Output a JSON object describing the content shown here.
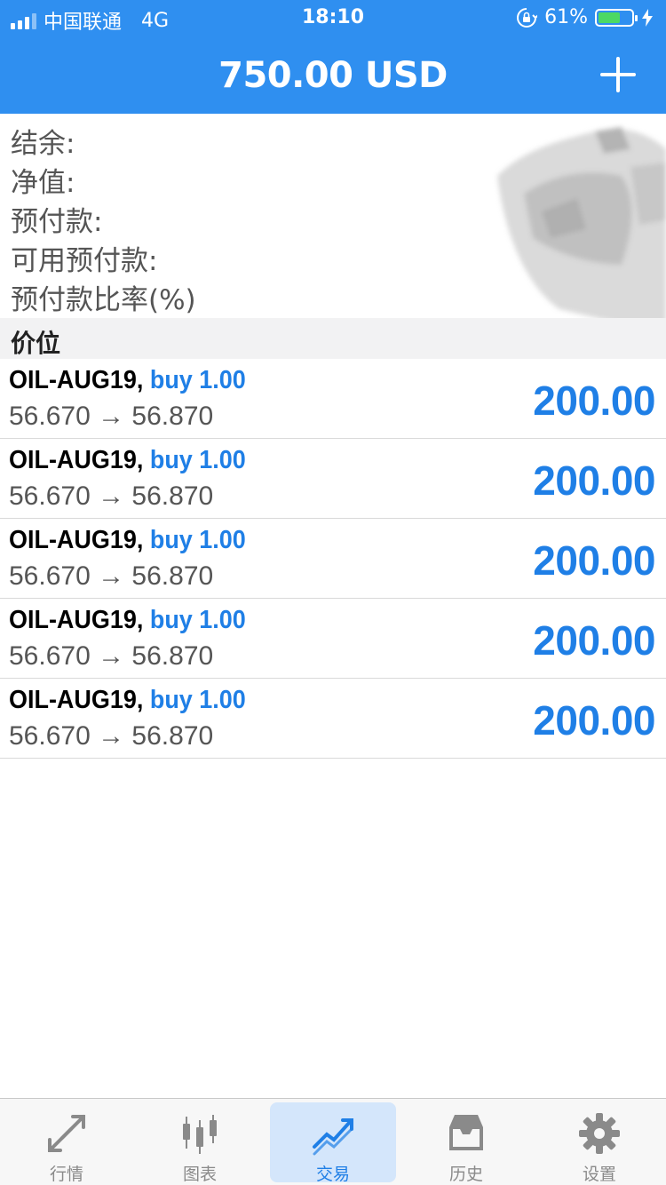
{
  "status_bar": {
    "carrier": "中国联通",
    "network": "4G",
    "time": "18:10",
    "battery": "61%"
  },
  "header": {
    "title": "750.00 USD"
  },
  "summary": {
    "balance_label": "结余:",
    "equity_label": "净值:",
    "margin_label": "预付款:",
    "free_margin_label": "可用预付款:",
    "margin_level_label": "预付款比率(%)"
  },
  "section": {
    "positions_title": "价位"
  },
  "positions": [
    {
      "symbol": "OIL-AUG19,",
      "side": "buy 1.00",
      "prices": "56.670 → 56.870",
      "profit": "200.00"
    },
    {
      "symbol": "OIL-AUG19,",
      "side": "buy 1.00",
      "prices": "56.670 → 56.870",
      "profit": "200.00"
    },
    {
      "symbol": "OIL-AUG19,",
      "side": "buy 1.00",
      "prices": "56.670 → 56.870",
      "profit": "200.00"
    },
    {
      "symbol": "OIL-AUG19,",
      "side": "buy 1.00",
      "prices": "56.670 → 56.870",
      "profit": "200.00"
    },
    {
      "symbol": "OIL-AUG19,",
      "side": "buy 1.00",
      "prices": "56.670 → 56.870",
      "profit": "200.00"
    }
  ],
  "tabs": [
    {
      "label": "行情",
      "icon": "quotes-arrows-icon"
    },
    {
      "label": "图表",
      "icon": "candlestick-chart-icon"
    },
    {
      "label": "交易",
      "icon": "trade-trend-icon"
    },
    {
      "label": "历史",
      "icon": "history-inbox-icon"
    },
    {
      "label": "设置",
      "icon": "gear-icon"
    }
  ],
  "colors": {
    "accent": "#2f8ff0",
    "profit_blue": "#1f7fe6",
    "battery_green": "#4cd964"
  }
}
